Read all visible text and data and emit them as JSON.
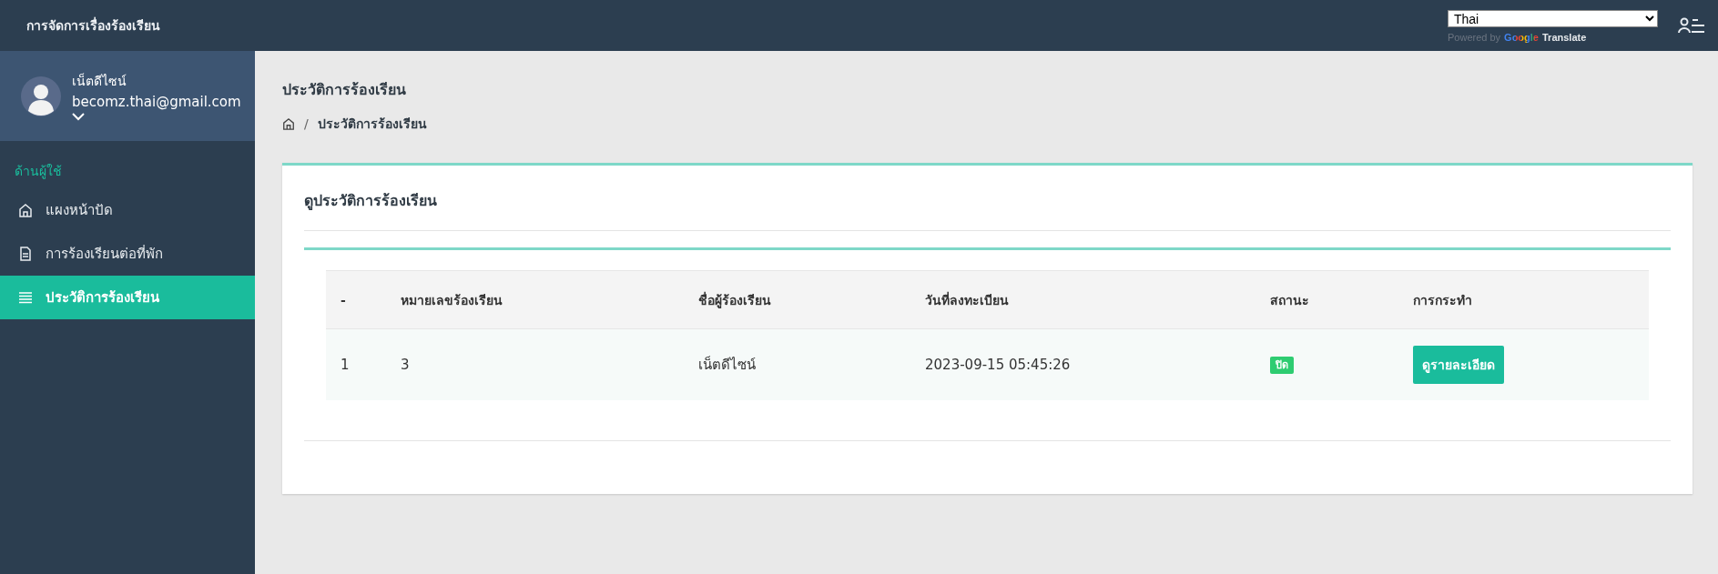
{
  "header": {
    "title": "การจัดการเรื่องร้องเรียน",
    "language_select": {
      "value": "Thai"
    },
    "powered_by": "Powered by",
    "google": "Google",
    "translate": "Translate"
  },
  "sidebar": {
    "user": {
      "name": "เน็ตดีไซน์",
      "email": "becomz.thai@gmail.com"
    },
    "section": "ด้านผู้ใช้",
    "items": [
      {
        "label": "แผงหน้าปัด",
        "kind": "home",
        "selected": false
      },
      {
        "label": "การร้องเรียนต่อที่พัก",
        "kind": "document",
        "selected": false
      },
      {
        "label": "ประวัติการร้องเรียน",
        "kind": "list",
        "selected": true
      }
    ]
  },
  "page": {
    "title": "ประวัติการร้องเรียน",
    "breadcrumb": [
      {
        "separator": "/",
        "label": "ประวัติการร้องเรียน"
      }
    ]
  },
  "card": {
    "title": "ดูประวัติการร้องเรียน",
    "table": {
      "columns": [
        "-",
        "หมายเลขร้องเรียน",
        "ชื่อผู้ร้องเรียน",
        "วันที่ลงทะเบียน",
        "สถานะ",
        "การกระทำ"
      ],
      "rows": [
        {
          "index": "1",
          "number": "3",
          "name": "เน็ตดีไซน์",
          "date": "2023-09-15 05:45:26",
          "status": "ปิด",
          "action": "ดูรายละเอียด"
        }
      ]
    }
  }
}
